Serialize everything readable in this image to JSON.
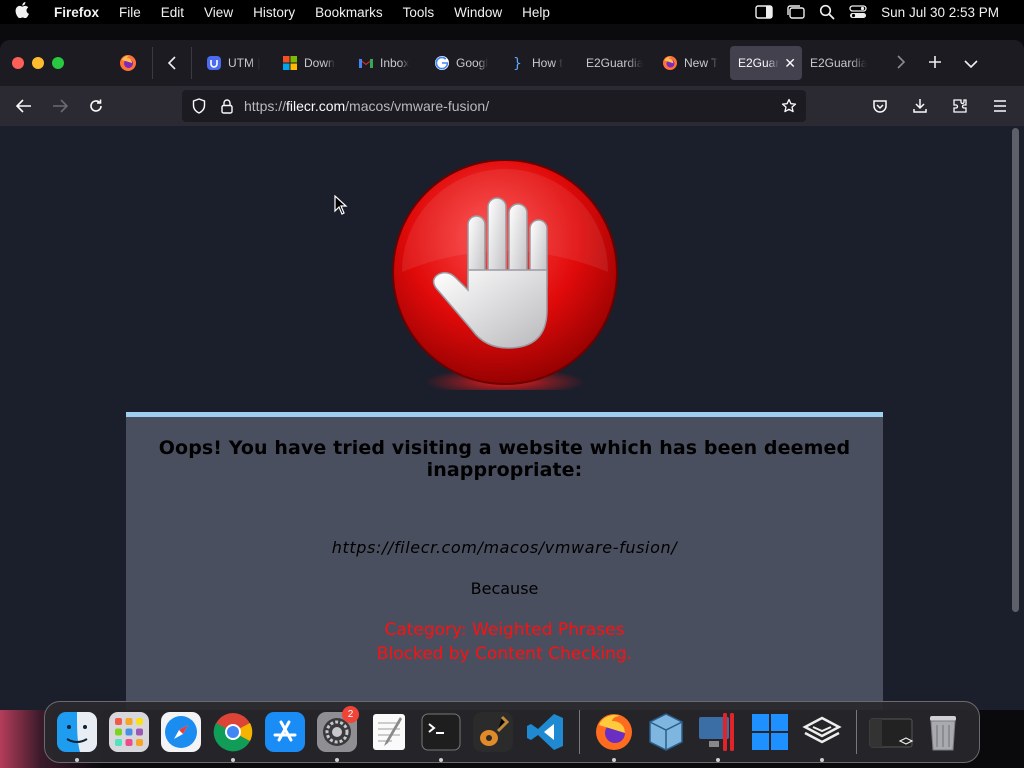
{
  "menubar": {
    "app_name": "Firefox",
    "items": [
      "File",
      "Edit",
      "View",
      "History",
      "Bookmarks",
      "Tools",
      "Window",
      "Help"
    ],
    "clock": "Sun Jul 30  2:53 PM"
  },
  "tabs": [
    {
      "label": "UTM |",
      "icon": "utm-icon",
      "active": false
    },
    {
      "label": "Down",
      "icon": "microsoft-icon",
      "active": false
    },
    {
      "label": "Inbox",
      "icon": "gmail-icon",
      "active": false
    },
    {
      "label": "Googl",
      "icon": "google-icon",
      "active": false
    },
    {
      "label": "How t",
      "icon": "vscode-brace-icon",
      "active": false
    },
    {
      "label": "E2Guardia",
      "icon": "",
      "active": false
    },
    {
      "label": "New T",
      "icon": "firefox-icon",
      "active": false
    },
    {
      "label": "E2Guar",
      "icon": "",
      "active": true
    },
    {
      "label": "E2Guardia",
      "icon": "",
      "active": false
    }
  ],
  "urlbar": {
    "prefix": "https://",
    "host": "filecr.com",
    "path": "/macos/vmware-fusion/"
  },
  "blockpage": {
    "title": "Oops! You have tried visiting a website which has been deemed inappropriate:",
    "url": "https://filecr.com/macos/vmware-fusion/",
    "because": "Because",
    "category": "Category: Weighted Phrases",
    "reason": "Blocked by Content Checking."
  },
  "dock": {
    "settings_badge": "2"
  },
  "colors": {
    "accent_border": "#9fd0f0",
    "reason_red": "#ff1010",
    "panel": "#4a4f5f",
    "page_bg": "#1b1e2b"
  }
}
